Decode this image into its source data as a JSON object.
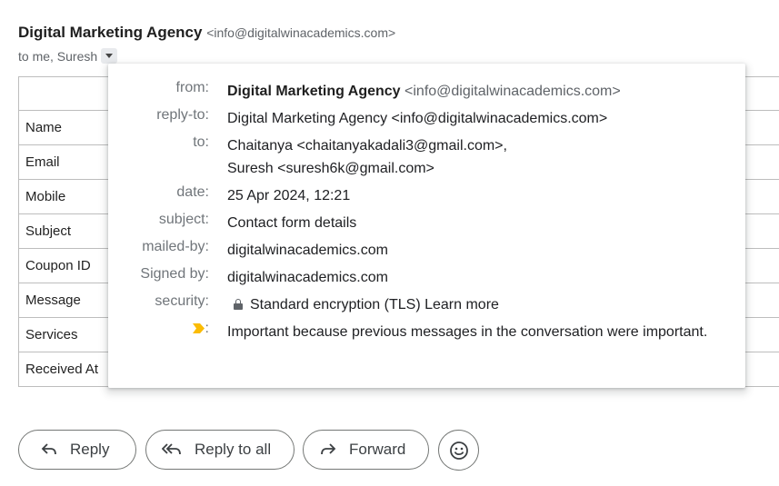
{
  "email": {
    "sender_name": "Digital Marketing Agency",
    "sender_email": "<info@digitalwinacademics.com>",
    "recipients_line": "to me, Suresh"
  },
  "form_table": {
    "rows": [
      "Name",
      "Email",
      "Mobile",
      "Subject",
      "Coupon ID",
      "Message",
      "Services",
      "Received At"
    ]
  },
  "details": {
    "from_label": "from:",
    "from_name": "Digital Marketing Agency",
    "from_email": "<info@digitalwinacademics.com>",
    "replyto_label": "reply-to:",
    "replyto_value": "Digital Marketing Agency <info@digitalwinacademics.com>",
    "to_label": "to:",
    "to_line1": "Chaitanya <chaitanyakadali3@gmail.com>,",
    "to_line2": "Suresh <suresh6k@gmail.com>",
    "date_label": "date:",
    "date_value": "25 Apr 2024, 12:21",
    "subject_label": "subject:",
    "subject_value": "Contact form details",
    "mailedby_label": "mailed-by:",
    "mailedby_value": "digitalwinacademics.com",
    "signedby_label": "Signed by:",
    "signedby_value": "digitalwinacademics.com",
    "security_label": "security:",
    "security_value": "Standard encryption (TLS)",
    "learn_more": "Learn more",
    "importance_label": ":",
    "importance_value": "Important because previous messages in the conversation were important.",
    "importance_color": "#fbbc04"
  },
  "actions": {
    "reply": "Reply",
    "reply_all": "Reply to all",
    "forward": "Forward"
  }
}
